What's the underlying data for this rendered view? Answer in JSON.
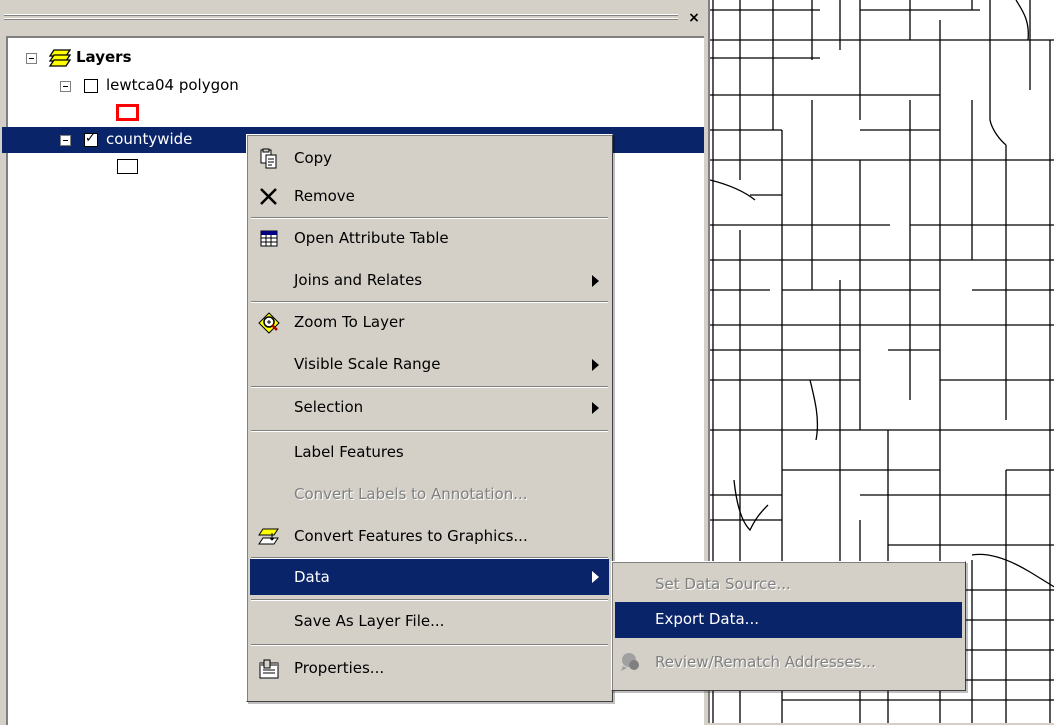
{
  "toc": {
    "close_glyph": "×",
    "root": {
      "label": "Layers",
      "icon": "layers-icon"
    },
    "layers": [
      {
        "name": "lewtca04 polygon",
        "checked": false,
        "symbol_color": "#ff0000"
      },
      {
        "name": "countywide",
        "checked": true,
        "symbol_color": "#000000",
        "selected": true
      }
    ]
  },
  "context_menu": {
    "items": [
      {
        "label": "Copy",
        "icon": "copy-icon"
      },
      {
        "label": "Remove",
        "icon": "remove-icon"
      },
      {
        "label": "Open Attribute Table",
        "icon": "table-icon"
      },
      {
        "label": "Joins and Relates",
        "submenu": true
      },
      {
        "label": "Zoom To Layer",
        "icon": "zoom-to-layer-icon"
      },
      {
        "label": "Visible Scale Range",
        "submenu": true
      },
      {
        "label": "Selection",
        "submenu": true
      },
      {
        "label": "Label Features"
      },
      {
        "label": "Convert Labels to Annotation...",
        "disabled": true
      },
      {
        "label": "Convert Features to Graphics...",
        "icon": "convert-graphics-icon"
      },
      {
        "label": "Data",
        "submenu": true,
        "highlighted": true
      },
      {
        "label": "Save As Layer File..."
      },
      {
        "label": "Properties...",
        "icon": "properties-icon"
      }
    ]
  },
  "data_submenu": {
    "items": [
      {
        "label": "Set Data Source...",
        "disabled": true
      },
      {
        "label": "Export Data...",
        "highlighted": true
      },
      {
        "label": "Review/Rematch Addresses...",
        "disabled": true,
        "icon": "review-addresses-icon"
      }
    ]
  },
  "colors": {
    "highlight": "#0a246a",
    "face": "#d4d0c8",
    "disabled_text": "#808080"
  }
}
